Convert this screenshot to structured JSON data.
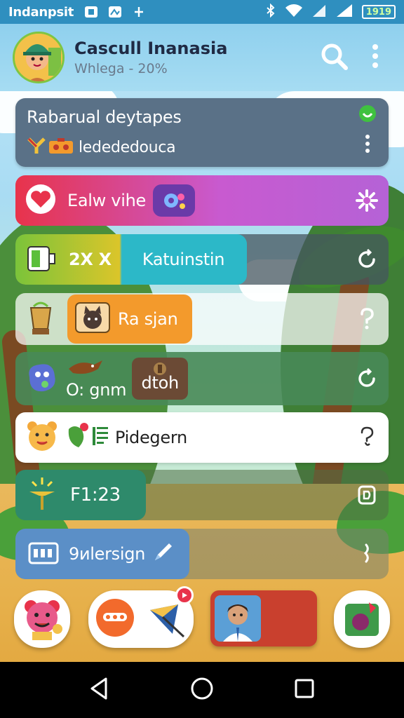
{
  "status_bar": {
    "carrier": "Indanpsit",
    "icons": [
      "notification-app-icon",
      "notification-image-icon",
      "plus-signal-icon"
    ],
    "right_icons": [
      "bluetooth-icon",
      "wifi-icon",
      "signal-icon",
      "signal-full-icon"
    ],
    "battery": "1919"
  },
  "header": {
    "title": "Cascull Inanasia",
    "subtitle": "Whlega - 20%",
    "avatar": "boy-with-hat-avatar",
    "actions": [
      "search-icon",
      "more-vertical-icon"
    ]
  },
  "cards": [
    {
      "id": "card-1",
      "title": "Rabarual deytapes",
      "subtitle": "ledededouca",
      "icons": [
        "y-icon",
        "toolbox-icon"
      ],
      "tail": "more-vertical-icon",
      "badge": "online-indicator-icon"
    },
    {
      "id": "card-2",
      "label": "Ealw vihe",
      "icons": [
        "heart-icon",
        "gear-badge-icon"
      ],
      "tail": "sparkle-icon"
    },
    {
      "id": "card-3",
      "badge_text": "2X X",
      "label": "Katuinstin",
      "icons": [
        "battery-icon"
      ],
      "tail": "refresh-icon"
    },
    {
      "id": "card-4",
      "label": "Ra sjan",
      "icons": [
        "trophy-cup-icon",
        "cat-icon"
      ],
      "tail": "help-icon"
    },
    {
      "id": "card-5",
      "label": "O: gnm",
      "label2": "dtoh",
      "icons": [
        "blob-monster-icon",
        "bird-icon",
        "chest-icon"
      ],
      "tail": "refresh-icon"
    },
    {
      "id": "card-6",
      "label": "Pidegern",
      "icons": [
        "bear-face-icon",
        "leaf-icon",
        "list-icon"
      ],
      "tail": "help-icon"
    },
    {
      "id": "card-7",
      "label": "F1:23",
      "icons": [
        "lamp-icon"
      ],
      "tail": "document-icon"
    },
    {
      "id": "card-8",
      "label": "9иlersign",
      "icons": [
        "calendar-icon",
        "pencil-icon"
      ],
      "tail": "exclamation-icon"
    }
  ],
  "dock": {
    "items": [
      "bear-mascot-icon",
      "face-icon",
      "kite-icon",
      "person-card-icon",
      "gift-camera-icon"
    ]
  },
  "nav": [
    "back-icon",
    "home-icon",
    "recents-icon"
  ],
  "colors": {
    "status_bar": "#2f8fbf",
    "card_1": "#5a7187",
    "card_2_start": "#e8334b",
    "card_2_end": "#c85ad0",
    "card_3_pill": "#2cb8c8",
    "card_4_pill": "#f39a2c",
    "card_5": "#4e8a5a",
    "card_6": "#ffffff",
    "card_7": "#2e8a6b",
    "card_8": "#5b8fc7"
  }
}
